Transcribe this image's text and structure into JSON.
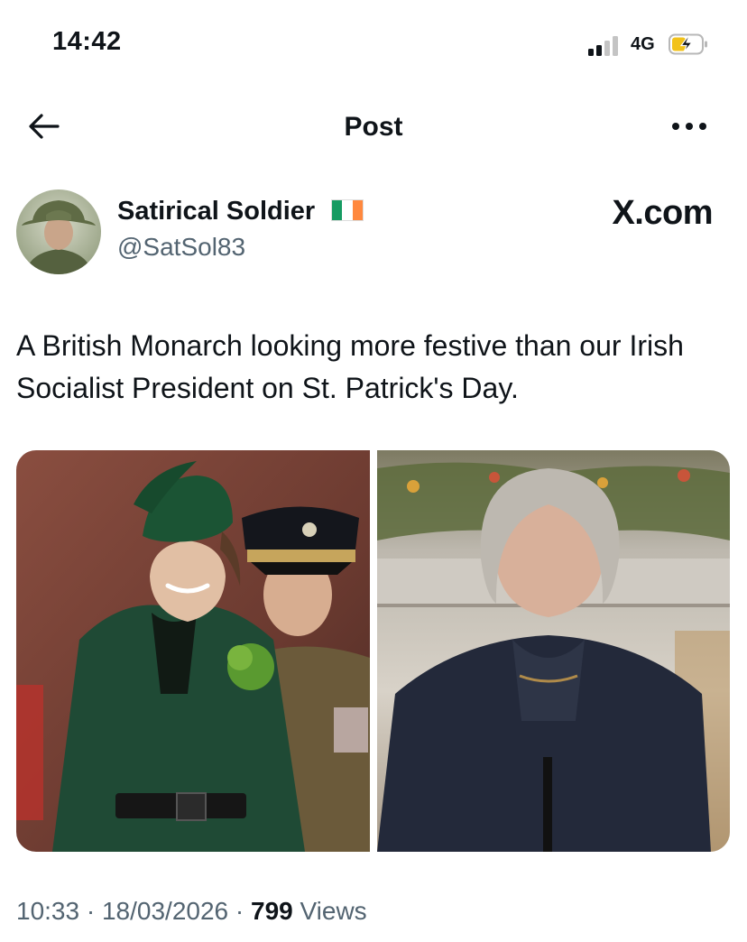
{
  "status_bar": {
    "time": "14:42",
    "network": "4G",
    "signal_icon": "signal-bars-icon",
    "battery_icon": "battery-charging-icon"
  },
  "header": {
    "title": "Post",
    "back_icon": "back-arrow-icon",
    "more_icon": "more-options-icon"
  },
  "post": {
    "author": {
      "display_name": "Satirical Soldier",
      "handle": "@SatSol83",
      "flag_icon": "ireland-flag-icon"
    },
    "source_watermark": "X.com",
    "text": "A British Monarch looking more festive than our Irish Socialist President on St. Patrick's Day.",
    "media": [
      {
        "name": "photo-left",
        "description_colors": {
          "coat": "#1f4a35",
          "background": "#6b3a30"
        }
      },
      {
        "name": "photo-right",
        "description_colors": {
          "jacket": "#23293a",
          "background": "#cfc8c0"
        }
      }
    ],
    "meta": {
      "time": "10:33",
      "separator": "·",
      "date": "18/03/2026",
      "views_count": "799",
      "views_label": "Views"
    }
  },
  "colors": {
    "text_primary": "#0f1419",
    "text_secondary": "#536471",
    "background": "#ffffff"
  }
}
